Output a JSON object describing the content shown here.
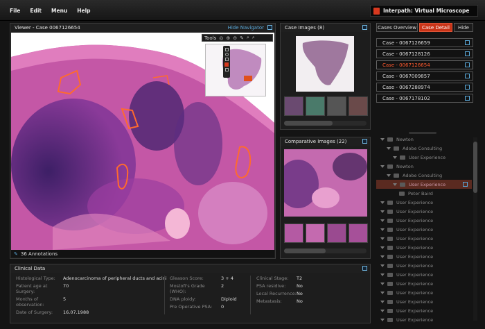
{
  "menu": [
    "File",
    "Edit",
    "Menu",
    "Help"
  ],
  "app_title": "Interpath: Virtual Microscope",
  "viewer": {
    "title": "Viewer - Case 0067126654",
    "hide_navigator": "Hide Navigator",
    "tools_label": "Tools",
    "annotations": "36 Annotations"
  },
  "case_images": {
    "title": "Case Images (8)"
  },
  "comparative_images": {
    "title": "Comparative Images (22)"
  },
  "tabs": [
    {
      "label": "Cases Overview",
      "active": false
    },
    {
      "label": "Case Detail",
      "active": true
    },
    {
      "label": "Hide",
      "active": false
    }
  ],
  "cases": [
    {
      "label": "Case - 0067126659",
      "active": false
    },
    {
      "label": "Case - 0067128126",
      "active": false
    },
    {
      "label": "Case - 0067126654",
      "active": true
    },
    {
      "label": "Case - 0067009857",
      "active": false
    },
    {
      "label": "Case - 0067288974",
      "active": false
    },
    {
      "label": "Case - 0067178102",
      "active": false
    }
  ],
  "tree": [
    {
      "label": "Newton",
      "level": 0,
      "highlight": false
    },
    {
      "label": "Adobe Consulting",
      "level": 1,
      "highlight": false
    },
    {
      "label": "User Experience",
      "level": 2,
      "highlight": false
    },
    {
      "label": "Newton",
      "level": 0,
      "highlight": false
    },
    {
      "label": "Adobe Consulting",
      "level": 1,
      "highlight": false
    },
    {
      "label": "User Experience",
      "level": 2,
      "highlight": true
    },
    {
      "label": "Peter Baird",
      "level": 3,
      "highlight": false
    },
    {
      "label": "User Experience",
      "level": 0,
      "highlight": false
    },
    {
      "label": "User Experience",
      "level": 0,
      "highlight": false
    },
    {
      "label": "User Experience",
      "level": 0,
      "highlight": false
    },
    {
      "label": "User Experience",
      "level": 0,
      "highlight": false
    },
    {
      "label": "User Experience",
      "level": 0,
      "highlight": false
    },
    {
      "label": "User Experience",
      "level": 0,
      "highlight": false
    },
    {
      "label": "User Experience",
      "level": 0,
      "highlight": false
    },
    {
      "label": "User Experience",
      "level": 0,
      "highlight": false
    },
    {
      "label": "User Experience",
      "level": 0,
      "highlight": false
    },
    {
      "label": "User Experience",
      "level": 0,
      "highlight": false
    },
    {
      "label": "User Experience",
      "level": 0,
      "highlight": false
    },
    {
      "label": "User Experience",
      "level": 0,
      "highlight": false
    },
    {
      "label": "User Experience",
      "level": 0,
      "highlight": false
    },
    {
      "label": "User Experience",
      "level": 0,
      "highlight": false
    },
    {
      "label": "User Experience",
      "level": 0,
      "highlight": false
    }
  ],
  "clinical": {
    "title": "Clinical Data",
    "col1": [
      {
        "label": "Histological Type:",
        "value": "Adenocarcinoma of peripheral ducts and acini"
      },
      {
        "label": "Patient age at Surgery:",
        "value": "70"
      },
      {
        "label": "Months of observation:",
        "value": "5"
      },
      {
        "label": "Date of Surgery:",
        "value": "16.07.1988"
      }
    ],
    "col2": [
      {
        "label": "Gleason Score:",
        "value": "3 + 4"
      },
      {
        "label": "Mostofi's Grade (WHO):",
        "value": "2"
      },
      {
        "label": "DNA ploidy:",
        "value": "Diploid"
      },
      {
        "label": "Pre Operative PSA:",
        "value": "0"
      }
    ],
    "col3": [
      {
        "label": "Clinical Stage:",
        "value": "T2"
      },
      {
        "label": "PSA residive:",
        "value": "No"
      },
      {
        "label": "Local Recurrence:",
        "value": "No"
      },
      {
        "label": "Metastasis:",
        "value": "No"
      }
    ]
  },
  "colors": {
    "accent": "#c93418",
    "link": "#5aa8d8",
    "tissue_pink": "#c65aa8",
    "tissue_purple": "#5a2a7a"
  }
}
